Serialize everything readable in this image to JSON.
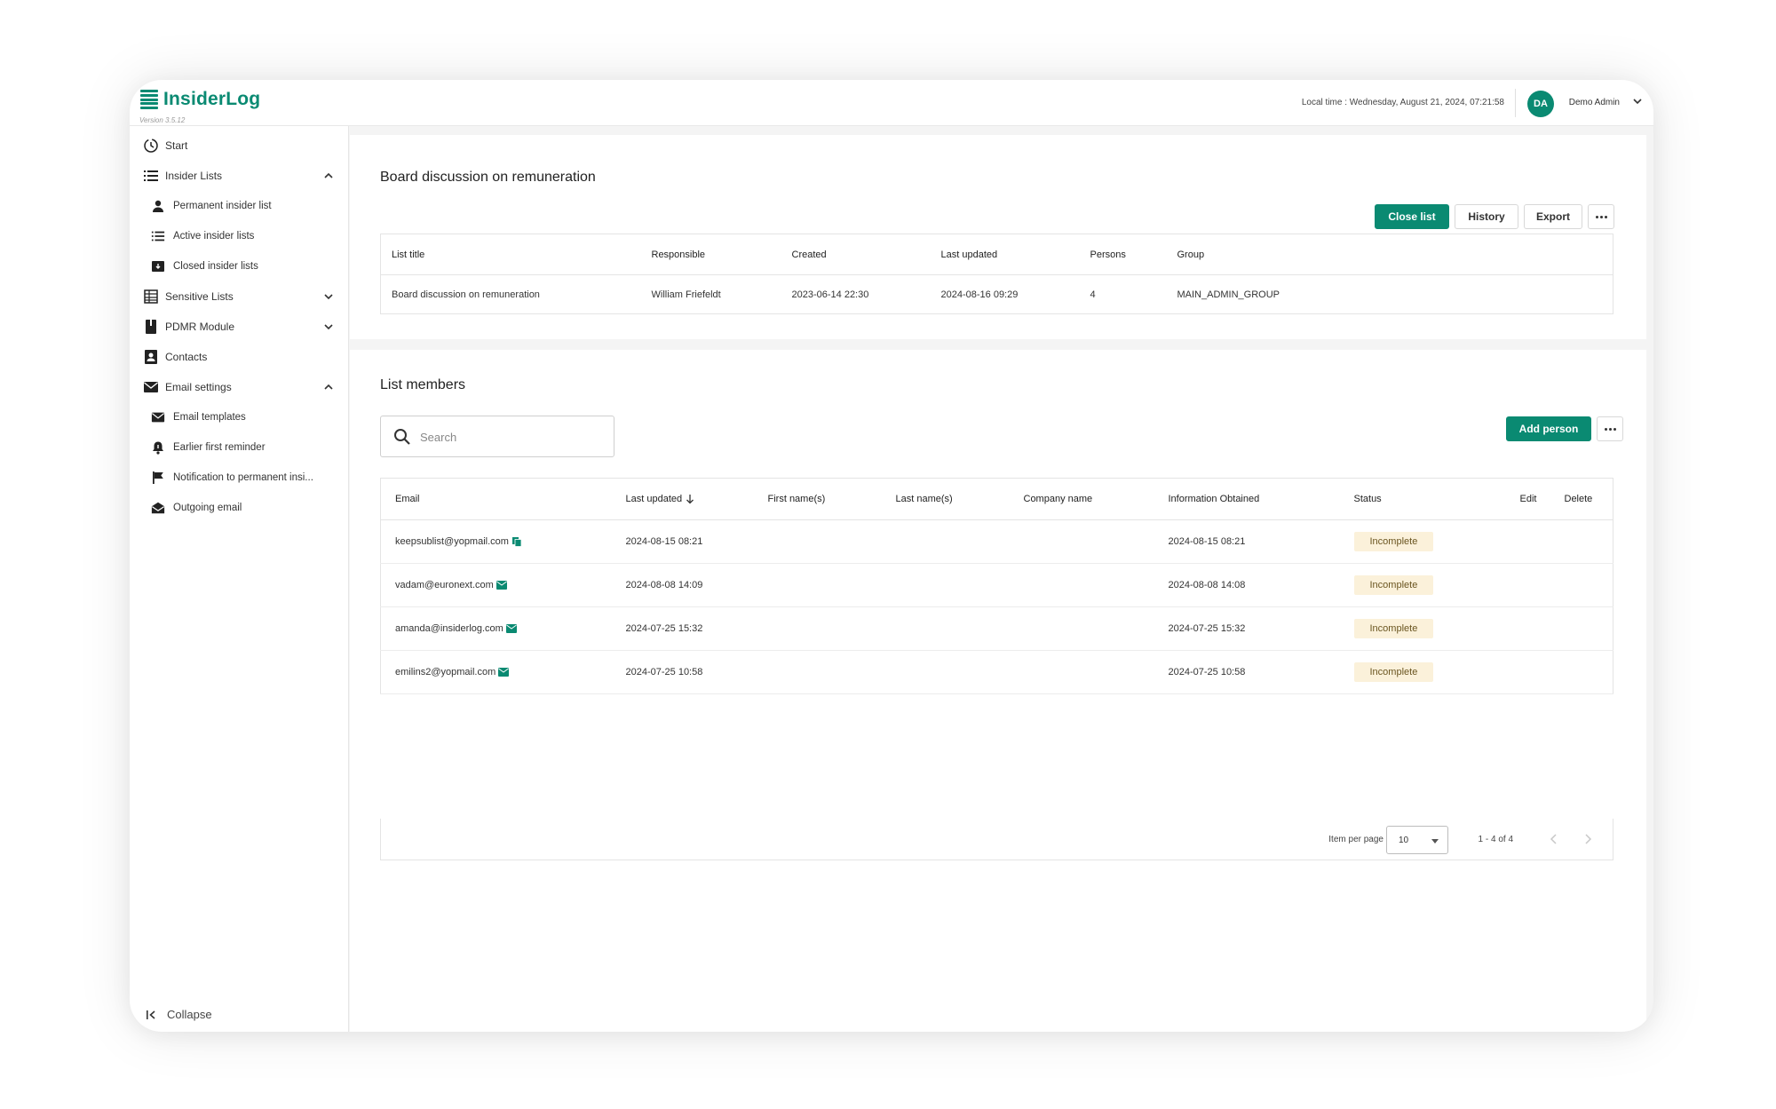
{
  "app": {
    "name": "InsiderLog",
    "version": "Version 3.5.12",
    "local_time": "Local time : Wednesday, August 21, 2024, 07:21:58",
    "user_initials": "DA",
    "user_name": "Demo Admin",
    "accent_color": "#0a8a72"
  },
  "sidebar": {
    "items": [
      {
        "label": "Start",
        "icon": "clock-icon"
      },
      {
        "label": "Insider Lists",
        "icon": "list-icon",
        "expanded": true
      },
      {
        "label": "Permanent insider list",
        "icon": "person-icon"
      },
      {
        "label": "Active insider lists",
        "icon": "list-icon"
      },
      {
        "label": "Closed insider lists",
        "icon": "archive-icon"
      },
      {
        "label": "Sensitive Lists",
        "icon": "table-icon",
        "expanded": false
      },
      {
        "label": "PDMR Module",
        "icon": "book-icon",
        "expanded": false
      },
      {
        "label": "Contacts",
        "icon": "contact-card-icon"
      },
      {
        "label": "Email settings",
        "icon": "envelope-icon",
        "expanded": true
      },
      {
        "label": "Email templates",
        "icon": "envelope-icon"
      },
      {
        "label": "Earlier first reminder",
        "icon": "bell-icon"
      },
      {
        "label": "Notification to permanent insi...",
        "icon": "flag-icon"
      },
      {
        "label": "Outgoing email",
        "icon": "open-envelope-icon"
      }
    ],
    "collapse_label": "Collapse"
  },
  "list": {
    "title": "Board discussion on remuneration",
    "actions": {
      "close": "Close list",
      "history": "History",
      "export": "Export"
    },
    "headers": [
      "List title",
      "Responsible",
      "Created",
      "Last updated",
      "Persons",
      "Group"
    ],
    "row": [
      "Board discussion on remuneration",
      "William Friefeldt",
      "2023-06-14 22:30",
      "2024-08-16 09:29",
      "4",
      "MAIN_ADMIN_GROUP"
    ]
  },
  "members": {
    "title": "List members",
    "search_placeholder": "Search",
    "add_person": "Add person",
    "headers": [
      "Email",
      "Last updated",
      "First name(s)",
      "Last name(s)",
      "Company name",
      "Information Obtained",
      "Status",
      "Edit",
      "Delete"
    ],
    "rows": [
      {
        "email": "keepsublist@yopmail.com",
        "icon": "copy-icon",
        "last_updated": "2024-08-15 08:21",
        "first_name": "",
        "last_name": "",
        "company": "",
        "obtained": "2024-08-15 08:21",
        "status": "Incomplete"
      },
      {
        "email": "vadam@euronext.com",
        "icon": "mail-icon",
        "last_updated": "2024-08-08 14:09",
        "first_name": "",
        "last_name": "",
        "company": "",
        "obtained": "2024-08-08 14:08",
        "status": "Incomplete"
      },
      {
        "email": "amanda@insiderlog.com",
        "icon": "mail-icon",
        "last_updated": "2024-07-25 15:32",
        "first_name": "",
        "last_name": "",
        "company": "",
        "obtained": "2024-07-25 15:32",
        "status": "Incomplete"
      },
      {
        "email": "emilins2@yopmail.com",
        "icon": "mail-icon",
        "last_updated": "2024-07-25 10:58",
        "first_name": "",
        "last_name": "",
        "company": "",
        "obtained": "2024-07-25 10:58",
        "status": "Incomplete"
      }
    ],
    "pager": {
      "label": "Item per page",
      "per_page": "10",
      "range": "1 - 4 of 4"
    }
  }
}
